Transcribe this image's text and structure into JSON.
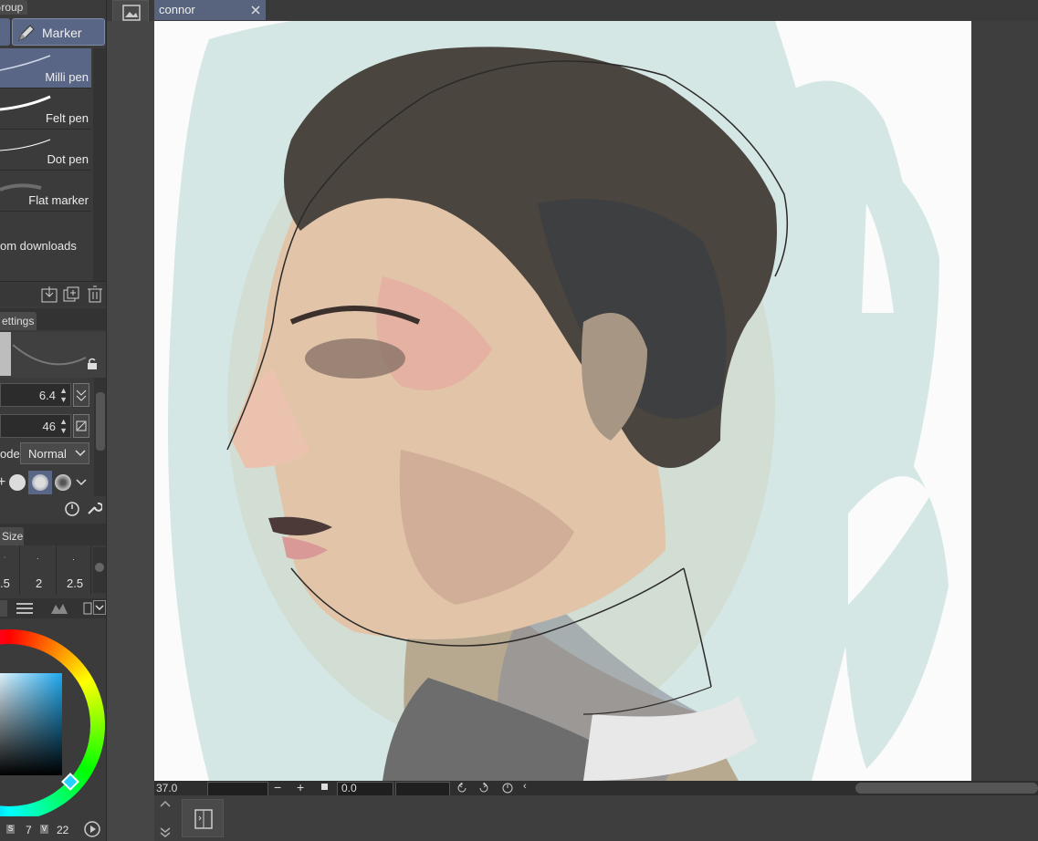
{
  "left_panel": {
    "group_tab": "Group",
    "marker_button": "Marker",
    "brushes": [
      {
        "label": "Milli pen",
        "selected": true
      },
      {
        "label": "Felt pen",
        "selected": false
      },
      {
        "label": "Dot pen",
        "selected": false
      },
      {
        "label": "Flat marker",
        "selected": false
      }
    ],
    "downloads_text": "om downloads",
    "settings_tab": "ettings",
    "size_value": "6.4",
    "opacity_value": "46",
    "blend_label": "ode",
    "blend_mode": "Normal",
    "size_tab": "Size",
    "size_presets": [
      ".5",
      "2",
      "2.5"
    ],
    "footer": {
      "s_label": "S",
      "s_value": "7",
      "v_label": "V",
      "v_value": "22"
    },
    "colors": {
      "selection": "#5a6685",
      "panel_bg": "#3b3b3b"
    }
  },
  "document": {
    "tab_title": "connor",
    "close_icon": "close-icon",
    "navigator_icon": "image-icon"
  },
  "status_bar": {
    "zoom": "37.0",
    "rotation": "0.0"
  }
}
